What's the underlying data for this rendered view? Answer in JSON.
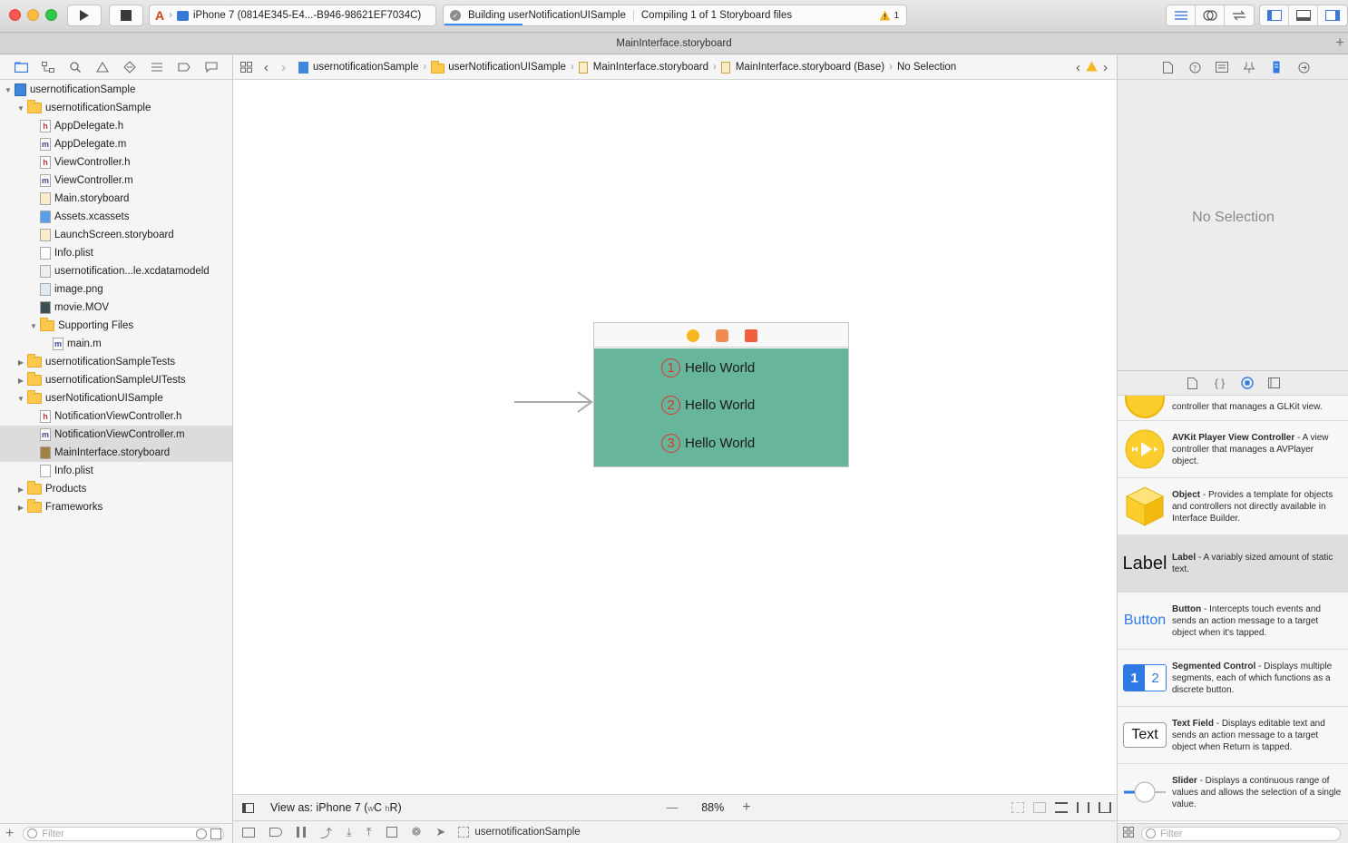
{
  "window": {
    "title": "MainInterface.storyboard",
    "colors": {
      "close": "#fc5753",
      "minimize": "#fdbc40",
      "zoom": "#33c748",
      "accent": "#3c8ef5",
      "scene_background": "#67b59b"
    }
  },
  "toolbar": {
    "run_icon": "play-icon",
    "stop_icon": "stop-icon",
    "scheme_device": "iPhone 7 (0814E345-E4...-B946-98621EF7034C)",
    "activity_step": "Building userNotificationUISample",
    "activity_detail": "Compiling 1 of 1 Storyboard files",
    "warning_count": "1"
  },
  "navigator": {
    "items": [
      {
        "label": "usernotificationSample",
        "type": "project",
        "indent": 0,
        "disclosure": "open"
      },
      {
        "label": "usernotificationSample",
        "type": "folder",
        "indent": 1,
        "disclosure": "open"
      },
      {
        "label": "AppDelegate.h",
        "type": "h",
        "indent": 2
      },
      {
        "label": "AppDelegate.m",
        "type": "m",
        "indent": 2
      },
      {
        "label": "ViewController.h",
        "type": "h",
        "indent": 2
      },
      {
        "label": "ViewController.m",
        "type": "m",
        "indent": 2
      },
      {
        "label": "Main.storyboard",
        "type": "storyboard",
        "indent": 2
      },
      {
        "label": "Assets.xcassets",
        "type": "assets",
        "indent": 2
      },
      {
        "label": "LaunchScreen.storyboard",
        "type": "storyboard",
        "indent": 2
      },
      {
        "label": "Info.plist",
        "type": "plist",
        "indent": 2
      },
      {
        "label": "usernotification...le.xcdatamodeld",
        "type": "model",
        "indent": 2
      },
      {
        "label": "image.png",
        "type": "image",
        "indent": 2
      },
      {
        "label": "movie.MOV",
        "type": "movie",
        "indent": 2
      },
      {
        "label": "Supporting Files",
        "type": "folder",
        "indent": 2,
        "disclosure": "open"
      },
      {
        "label": "main.m",
        "type": "m",
        "indent": 3
      },
      {
        "label": "usernotificationSampleTests",
        "type": "folder",
        "indent": 1,
        "disclosure": "closed"
      },
      {
        "label": "usernotificationSampleUITests",
        "type": "folder",
        "indent": 1,
        "disclosure": "closed"
      },
      {
        "label": "userNotificationUISample",
        "type": "folder",
        "indent": 1,
        "disclosure": "open"
      },
      {
        "label": "NotificationViewController.h",
        "type": "h",
        "indent": 2
      },
      {
        "label": "NotificationViewController.m",
        "type": "m",
        "indent": 2,
        "selected": true
      },
      {
        "label": "MainInterface.storyboard",
        "type": "storyboard-dark",
        "indent": 2,
        "selected": true
      },
      {
        "label": "Info.plist",
        "type": "plist",
        "indent": 2
      },
      {
        "label": "Products",
        "type": "folder",
        "indent": 1,
        "disclosure": "closed"
      },
      {
        "label": "Frameworks",
        "type": "folder",
        "indent": 1,
        "disclosure": "closed"
      }
    ],
    "filter_placeholder": "Filter"
  },
  "jumpbar": {
    "crumbs": [
      "usernotificationSample",
      "userNotificationUISample",
      "MainInterface.storyboard",
      "MainInterface.storyboard (Base)",
      "No Selection"
    ]
  },
  "canvas": {
    "labels": [
      {
        "number": "1",
        "text": "Hello World"
      },
      {
        "number": "2",
        "text": "Hello World"
      },
      {
        "number": "3",
        "text": "Hello World"
      }
    ]
  },
  "editor_bottom": {
    "view_as": "View as: iPhone 7 (",
    "size_class_w": "w",
    "size_class_w_value": "C",
    "size_class_h": "h",
    "size_class_h_value": "R",
    "close_paren": ")",
    "zoom_out": "—",
    "zoom": "88%",
    "zoom_in": "+"
  },
  "debug_bar": {
    "target": "usernotificationSample"
  },
  "inspector": {
    "no_selection": "No Selection"
  },
  "library": {
    "items": [
      {
        "icon": "glkit-icon",
        "title": "",
        "desc": "controller that manages a GLKit view."
      },
      {
        "icon": "avkit-icon",
        "title": "AVKit Player View Controller",
        "desc": " - A view controller that manages a AVPlayer object."
      },
      {
        "icon": "object-cube-icon",
        "title": "Object",
        "desc": " - Provides a template for objects and controllers not directly available in Interface Builder."
      },
      {
        "icon": "label-text",
        "sample": "Label",
        "title": "Label",
        "desc": " - A variably sized amount of static text.",
        "selected": true
      },
      {
        "icon": "button-text",
        "sample": "Button",
        "title": "Button",
        "desc": " - Intercepts touch events and sends an action message to a target object when it's tapped."
      },
      {
        "icon": "segmented-icon",
        "sample_a": "1",
        "sample_b": "2",
        "title": "Segmented Control",
        "desc": " - Displays multiple segments, each of which functions as a discrete button."
      },
      {
        "icon": "textfield-icon",
        "sample": "Text",
        "title": "Text Field",
        "desc": " - Displays editable text and sends an action message to a target object when Return is tapped."
      },
      {
        "icon": "slider-icon",
        "title": "Slider",
        "desc": " - Displays a continuous range of values and allows the selection of a single value."
      }
    ],
    "filter_placeholder": "Filter"
  }
}
